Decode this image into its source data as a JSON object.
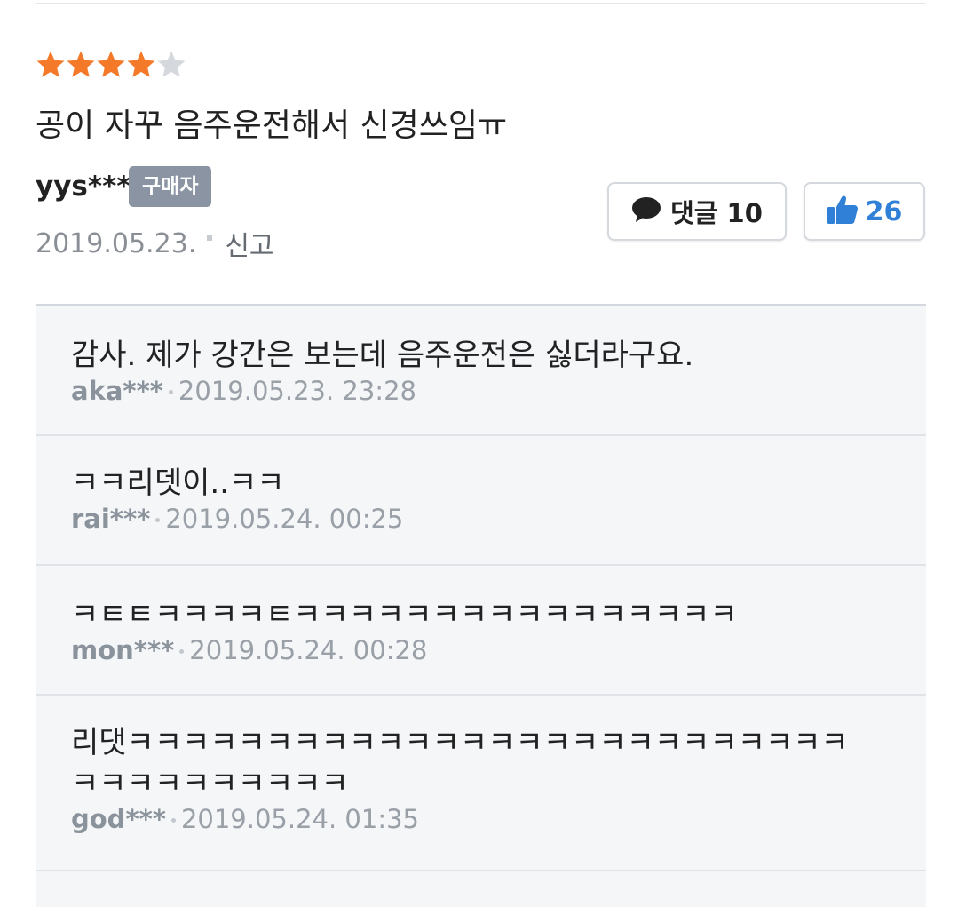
{
  "review": {
    "rating": 4,
    "rating_max": 5,
    "text": "공이 자꾸 음주운전해서 신경쓰임ㅠ",
    "author": "yys***",
    "badge": "구매자",
    "date": "2019.05.23.",
    "report_label": "신고",
    "comment_button": {
      "icon": "speech-bubble-icon",
      "label": "댓글 10"
    },
    "like_button": {
      "icon": "thumbs-up-icon",
      "count": "26"
    }
  },
  "comments": [
    {
      "text": "감사. 제가 강간은 보는데 음주운전은 싫더라구요.",
      "author": "aka***",
      "datetime": "2019.05.23. 23:28"
    },
    {
      "text": "ㅋㅋ리뎃이..ㅋㅋ",
      "author": "rai***",
      "datetime": "2019.05.24. 00:25"
    },
    {
      "text": "ㅋㅌㅌㅋㅋㅋㅋㅌㅋㅋㅋㅋㅋㅋㅋㅋㅋㅋㅋㅋㅋㅋㅋㅋ",
      "author": "mon***",
      "datetime": "2019.05.24. 00:28"
    },
    {
      "text": "리댓ㅋㅋㅋㅋㅋㅋㅋㅋㅋㅋㅋㅋㅋㅋㅋㅋㅋㅋㅋㅋㅋㅋㅋㅋㅋㅋㅋㅋㅋㅋㅋㅋㅋㅋㅋㅋ",
      "author": "god***",
      "datetime": "2019.05.24. 01:35"
    }
  ],
  "colors": {
    "star_filled": "#f47a2a",
    "star_empty": "#d5d8dc",
    "like_accent": "#2f80d6",
    "badge_bg": "#8a94a3",
    "comment_bg": "#f4f6f8"
  }
}
